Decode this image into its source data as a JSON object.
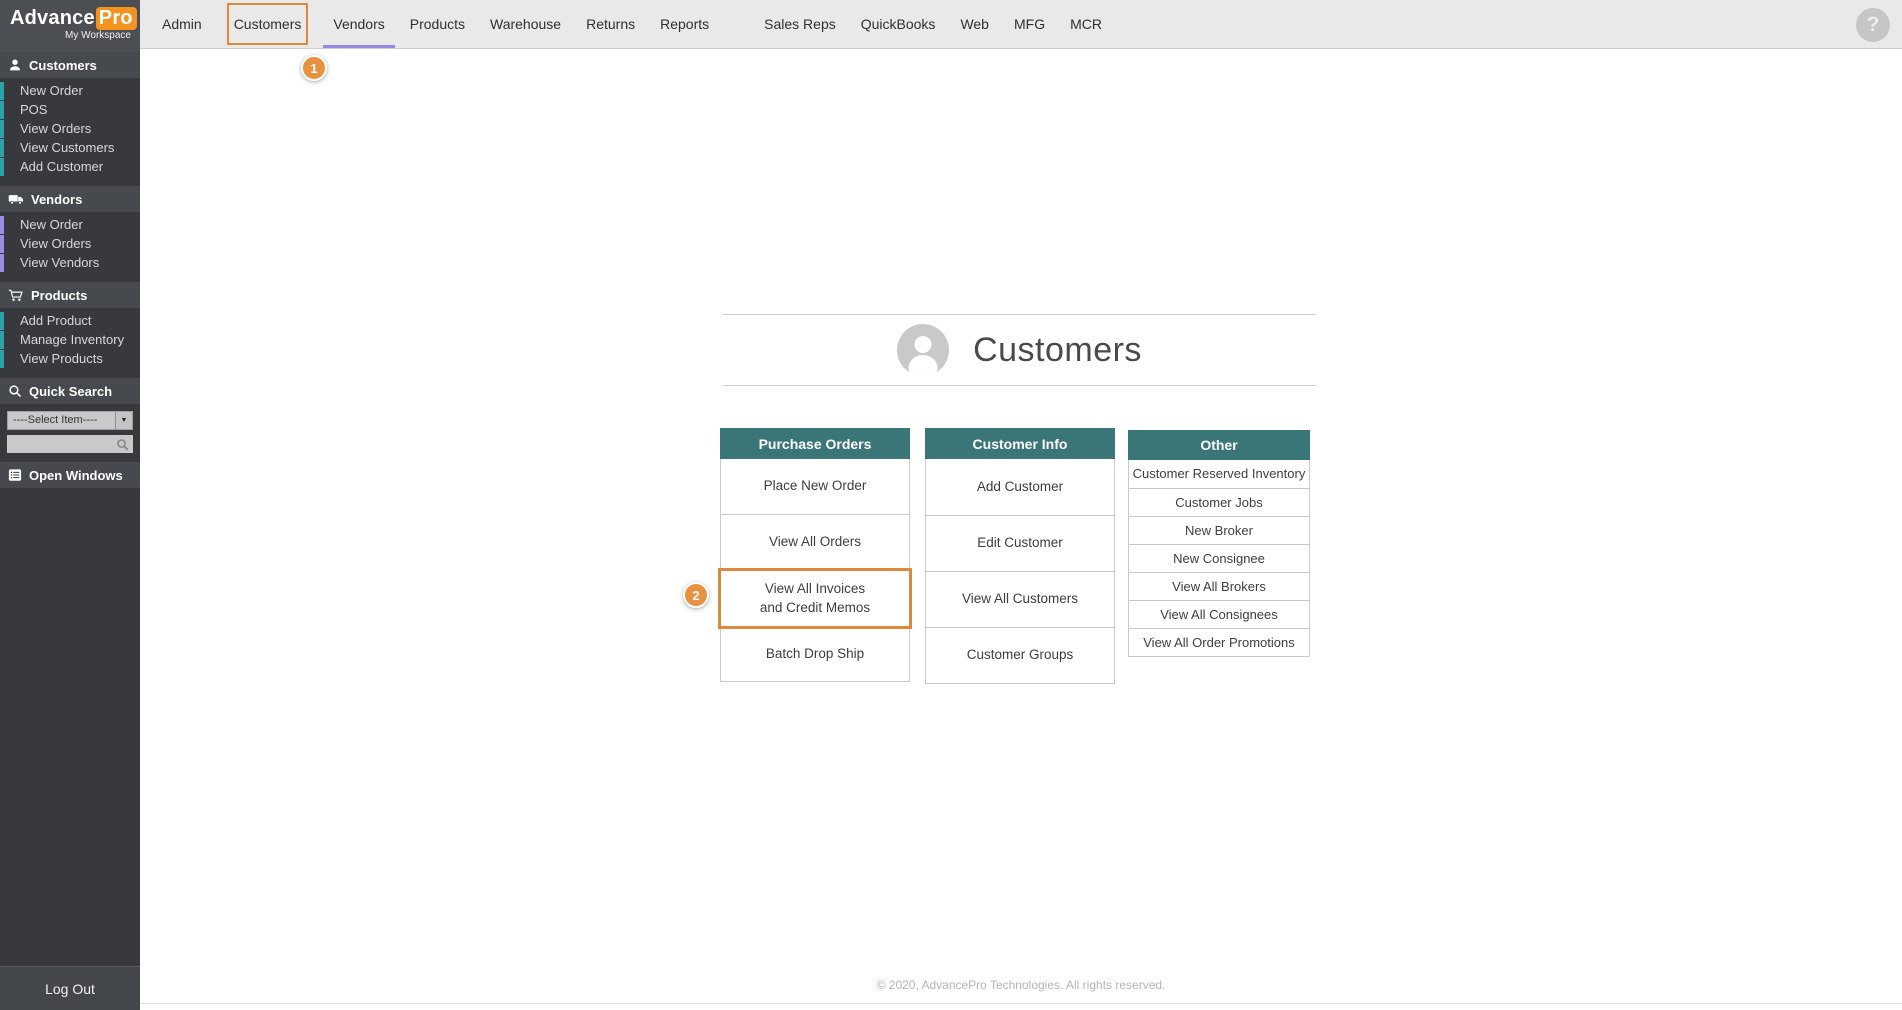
{
  "logo": {
    "brand_advance": "Advance",
    "brand_pro": "Pro",
    "tagline": "My Workspace"
  },
  "nav": {
    "items": [
      "Admin",
      "Customers",
      "Vendors",
      "Products",
      "Warehouse",
      "Returns",
      "Reports",
      "Sales Reps",
      "QuickBooks",
      "Web",
      "MFG",
      "MCR"
    ],
    "highlighted_item": "Customers",
    "underlined_item": "Vendors"
  },
  "help": {
    "label": "?"
  },
  "badges": {
    "step1": "1",
    "step2": "2"
  },
  "sidebar": {
    "sections": [
      {
        "title": "Customers",
        "icon": "person-icon",
        "accent": "#2aa3ab",
        "items": [
          "New Order",
          "POS",
          "View Orders",
          "View Customers",
          "Add Customer"
        ]
      },
      {
        "title": "Vendors",
        "icon": "truck-icon",
        "accent": "#9a8ce4",
        "items": [
          "New Order",
          "View Orders",
          "View Vendors"
        ]
      },
      {
        "title": "Products",
        "icon": "cart-icon",
        "accent": "#2aa3ab",
        "items": [
          "Add Product",
          "Manage Inventory",
          "View Products"
        ]
      }
    ],
    "quick_search": {
      "title": "Quick Search",
      "select_value": "----Select Item----",
      "search_value": ""
    },
    "open_windows": {
      "title": "Open Windows"
    },
    "logout_label": "Log Out"
  },
  "main": {
    "title": "Customers",
    "columns": [
      {
        "header": "Purchase Orders",
        "cells": [
          "Place New Order",
          "View All Orders",
          "View All Invoices\nand Credit Memos",
          "Batch Drop Ship"
        ],
        "highlighted_cell": "View All Invoices and Credit Memos"
      },
      {
        "header": "Customer Info",
        "cells": [
          "Add Customer",
          "Edit Customer",
          "View All Customers",
          "Customer Groups"
        ]
      },
      {
        "header": "Other",
        "cells": [
          "Customer Reserved Inventory",
          "Customer Jobs",
          "New Broker",
          "New Consignee",
          "View All Brokers",
          "View All Consignees",
          "View All Order Promotions"
        ]
      }
    ],
    "footer": "© 2020, AdvancePro Technologies. All rights reserved."
  },
  "colors": {
    "accent_orange": "#dd8a3c",
    "badge_orange": "#e8923f",
    "teal_header": "#3a7678",
    "teal_bar": "#2aa3ab",
    "purple_bar": "#9a8ce4",
    "purple_underline": "#9588e3",
    "sidebar_bg": "#37393d",
    "nav_bg": "#e9e9e9"
  }
}
